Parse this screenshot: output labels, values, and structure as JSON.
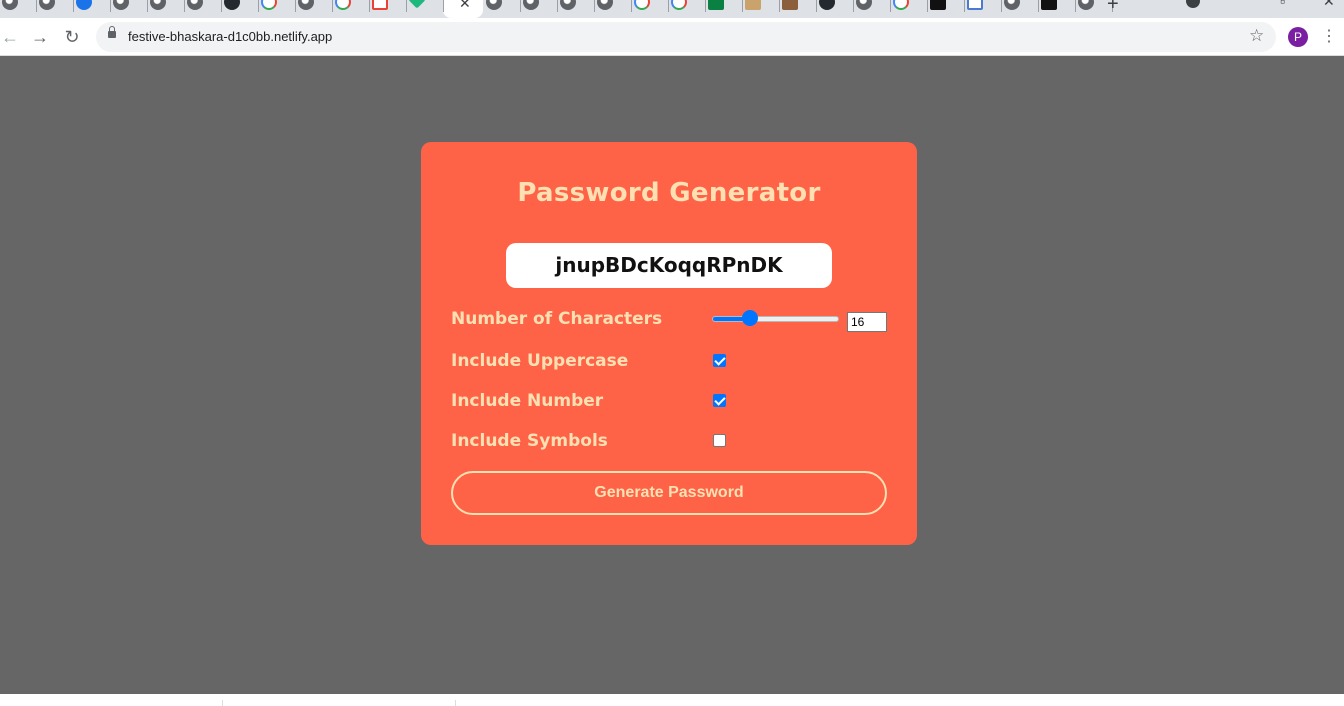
{
  "browser": {
    "tabs": [
      {
        "icon": "globe-icon",
        "cls": "globe"
      },
      {
        "icon": "globe-icon",
        "cls": "globe"
      },
      {
        "icon": "compass-icon",
        "cls": "blue"
      },
      {
        "icon": "globe-icon",
        "cls": "globe"
      },
      {
        "icon": "globe-icon",
        "cls": "globe"
      },
      {
        "icon": "globe-icon",
        "cls": "globe"
      },
      {
        "icon": "github-icon",
        "cls": "gh"
      },
      {
        "icon": "google-icon",
        "cls": "g"
      },
      {
        "icon": "globe-icon",
        "cls": "globe"
      },
      {
        "icon": "google-icon",
        "cls": "g"
      },
      {
        "icon": "gmail-icon",
        "cls": "mail"
      },
      {
        "icon": "gem-icon",
        "cls": "gem"
      },
      {
        "icon": "close-icon",
        "cls": "active"
      },
      {
        "icon": "globe-icon",
        "cls": "globe"
      },
      {
        "icon": "globe-icon",
        "cls": "globe"
      },
      {
        "icon": "globe-icon",
        "cls": "globe"
      },
      {
        "icon": "globe-icon",
        "cls": "globe"
      },
      {
        "icon": "google-icon",
        "cls": "g"
      },
      {
        "icon": "google-icon",
        "cls": "g"
      },
      {
        "icon": "w-icon",
        "cls": "w"
      },
      {
        "icon": "document-icon",
        "cls": "pdf"
      },
      {
        "icon": "box-icon",
        "cls": "box"
      },
      {
        "icon": "github-icon",
        "cls": "gh"
      },
      {
        "icon": "globe-icon",
        "cls": "globe"
      },
      {
        "icon": "google-icon",
        "cls": "g"
      },
      {
        "icon": "dark-app-icon",
        "cls": "dark"
      },
      {
        "icon": "flag-icon",
        "cls": "flag"
      },
      {
        "icon": "globe-icon",
        "cls": "globe"
      },
      {
        "icon": "dark-app-icon",
        "cls": "dark"
      },
      {
        "icon": "globe-icon",
        "cls": "globe"
      }
    ],
    "active_tab_close": "✕",
    "new_tab": "+",
    "url": "festive-bhaskara-d1c0bb.netlify.app",
    "back": "←",
    "forward": "→",
    "reload": "↻",
    "star": "☆",
    "profile_initial": "P",
    "menu": "⋮",
    "profile_color": "#7b1fa2"
  },
  "app": {
    "title": "Password Generator",
    "password": "jnupBDcKoqqRPnDK",
    "length_label": "Number of Characters",
    "length_value": "16",
    "length_slider_fraction": 0.27,
    "uppercase_label": "Include Uppercase",
    "uppercase_checked": true,
    "numbers_label": "Include Number",
    "numbers_checked": true,
    "symbols_label": "Include Symbols",
    "symbols_checked": false,
    "button_label": "Generate Password",
    "colors": {
      "background": "#666666",
      "card": "#ff6347",
      "accent_text": "#ffe0b2",
      "control_accent": "#0075ff"
    }
  }
}
